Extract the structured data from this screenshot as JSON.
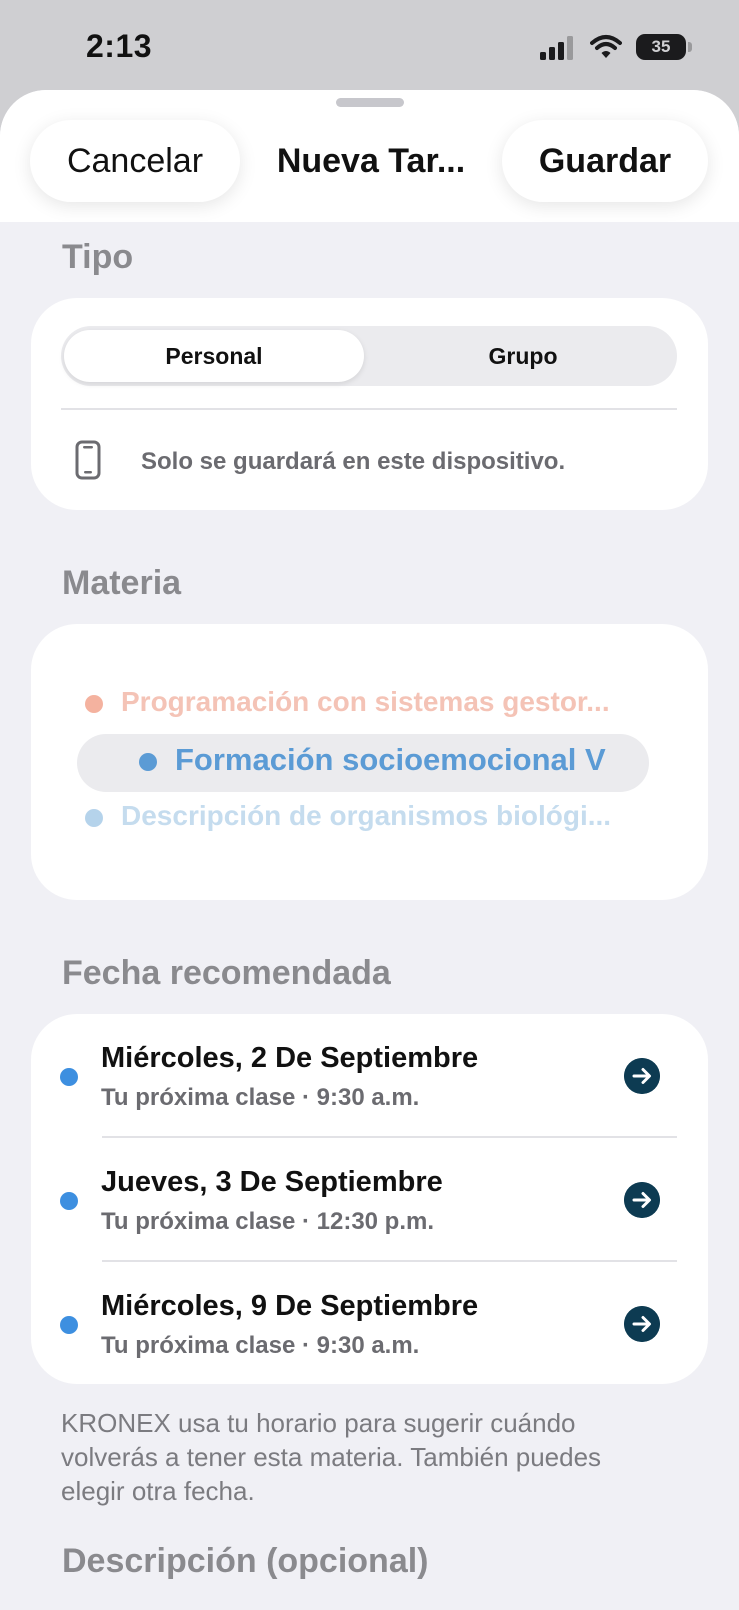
{
  "status_bar": {
    "time": "2:13",
    "battery": "35"
  },
  "nav": {
    "cancel_label": "Cancelar",
    "title": "Nueva Tar...",
    "save_label": "Guardar"
  },
  "tipo": {
    "section_title": "Tipo",
    "options": [
      "Personal",
      "Grupo"
    ],
    "selected": "Personal",
    "note": "Solo se guardará en este dispositivo."
  },
  "materia": {
    "section_title": "Materia",
    "items": [
      {
        "label": "Programación con sistemas gestor...",
        "color": "#f3a58f"
      },
      {
        "label": "Formación socioemocional V",
        "color": "#5b9bd5",
        "selected": true
      },
      {
        "label": "Descripción de organismos biológi...",
        "color": "#a9cce8"
      }
    ]
  },
  "fecha": {
    "section_title": "Fecha recomendada",
    "options": [
      {
        "date": "Miércoles, 2 De Septiembre",
        "detail": "Tu próxima clase · 9:30 a.m."
      },
      {
        "date": "Jueves, 3 De Septiembre",
        "detail": "Tu próxima clase · 12:30 p.m."
      },
      {
        "date": "Miércoles, 9 De Septiembre",
        "detail": "Tu próxima clase · 9:30 a.m."
      }
    ],
    "footnote": "KRONEX usa tu horario para sugerir cuándo volverás a tener esta materia. También puedes elegir otra fecha."
  },
  "descripcion": {
    "section_title": "Descripción (opcional)"
  },
  "colors": {
    "accent_dark": "#0d3b52",
    "date_dot": "#3d8fe0"
  }
}
